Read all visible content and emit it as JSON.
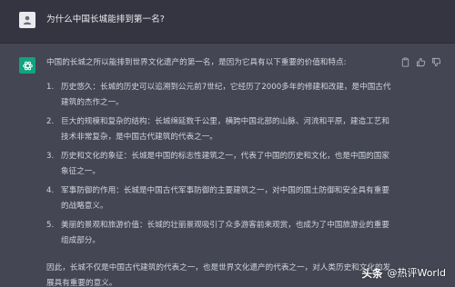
{
  "question": {
    "text": "为什么中国长城能排到第一名?"
  },
  "answer": {
    "intro": "中国的长城之所以能排到世界文化遗产的第一名，是因为它具有以下重要的价值和特点:",
    "items": [
      {
        "num": "1.",
        "text": "历史悠久：长城的历史可以追溯到公元前7世纪，它经历了2000多年的修建和改建，是中国古代建筑的杰作之一。"
      },
      {
        "num": "2.",
        "text": "巨大的规模和复杂的结构：长城绵延数千公里，横跨中国北部的山脉、河流和平原，建造工艺和技术非常复杂，是中国古代建筑的代表之一。"
      },
      {
        "num": "3.",
        "text": "历史和文化的象征：长城是中国的标志性建筑之一，代表了中国的历史和文化，也是中国的国家象征之一。"
      },
      {
        "num": "4.",
        "text": "军事防御的作用：长城是中国古代军事防御的主要建筑之一，对中国的国土防御和安全具有重要的战略意义。"
      },
      {
        "num": "5.",
        "text": "美丽的景观和旅游价值：长城的壮丽景观吸引了众多游客前来观赏，也成为了中国旅游业的重要组成部分。"
      }
    ],
    "conclusion": "因此，长城不仅是中国古代建筑的代表之一，也是世界文化遗产的代表之一，对人类历史和文化的发展具有重要的意义。"
  },
  "watermark": {
    "logo": "头条",
    "handle": "@热评World"
  },
  "colors": {
    "question_bg": "#343541",
    "answer_bg": "#444654",
    "bot_avatar": "#10a37f",
    "text": "#d1d5db"
  },
  "icons": {
    "user_avatar": "user-avatar-icon",
    "bot_avatar": "openai-logo-icon",
    "copy": "clipboard-icon",
    "like": "thumbs-up-icon",
    "dislike": "thumbs-down-icon"
  }
}
